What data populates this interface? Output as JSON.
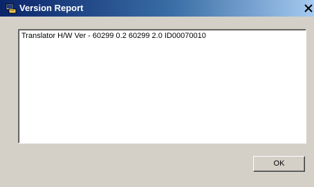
{
  "window": {
    "title": "Version Report",
    "icon": "app-icon",
    "close_icon": "close-icon"
  },
  "report": {
    "text": "Translator H/W Ver - 60299 0.2 60299 2.0 ID00070010"
  },
  "buttons": {
    "ok_label": "OK"
  },
  "colors": {
    "titlebar_start": "#0a246a",
    "titlebar_end": "#a6caf0",
    "face": "#d4d0c8",
    "text_area": "#ffffff"
  }
}
